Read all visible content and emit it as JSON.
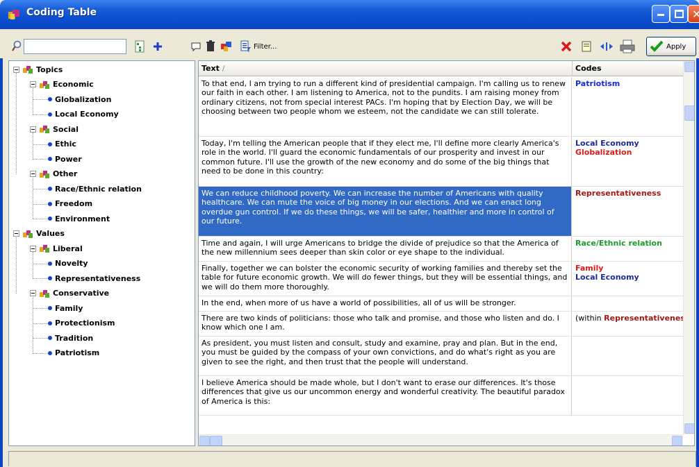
{
  "window": {
    "title": "Coding Table",
    "accent": "#0a47c0"
  },
  "toolbar": {
    "search_value": "",
    "filter_label": "Filter...",
    "apply_label": "Apply",
    "icons": [
      "search-icon",
      "tree-view-icon",
      "add-icon",
      "comment-icon",
      "delete-icon",
      "recode-icon",
      "filter-icon",
      "clear-codes-icon",
      "memo-icon",
      "fit-columns-icon",
      "print-icon",
      "checkmark-icon"
    ]
  },
  "tree": {
    "nodes": [
      {
        "label": "Topics",
        "type": "folder",
        "level": 0
      },
      {
        "label": "Economic",
        "type": "folder",
        "level": 1
      },
      {
        "label": "Globalization",
        "type": "code",
        "level": 2
      },
      {
        "label": "Local Economy",
        "type": "code",
        "level": 2
      },
      {
        "label": "Social",
        "type": "folder",
        "level": 1
      },
      {
        "label": "Ethic",
        "type": "code",
        "level": 2
      },
      {
        "label": "Power",
        "type": "code",
        "level": 2
      },
      {
        "label": "Other",
        "type": "folder",
        "level": 1
      },
      {
        "label": "Race/Ethnic relation",
        "type": "code",
        "level": 2
      },
      {
        "label": "Freedom",
        "type": "code",
        "level": 2
      },
      {
        "label": "Environment",
        "type": "code",
        "level": 2
      },
      {
        "label": "Values",
        "type": "folder",
        "level": 0
      },
      {
        "label": "Liberal",
        "type": "folder",
        "level": 1
      },
      {
        "label": "Novelty",
        "type": "code",
        "level": 2
      },
      {
        "label": "Representativeness",
        "type": "code",
        "level": 2
      },
      {
        "label": "Conservative",
        "type": "folder",
        "level": 1
      },
      {
        "label": "Family",
        "type": "code",
        "level": 2
      },
      {
        "label": "Protectionism",
        "type": "code",
        "level": 2
      },
      {
        "label": "Tradition",
        "type": "code",
        "level": 2
      },
      {
        "label": "Patriotism",
        "type": "code",
        "level": 2
      }
    ]
  },
  "table": {
    "columns": [
      "Text",
      "Codes"
    ],
    "sort_indicator": "/",
    "rows": [
      {
        "text": "To that end, I am trying to run a different kind of presidential campaign. I'm calling us to renew our faith in each other. I am listening to America, not to the pundits. I am raising money from ordinary citizens, not from special interest PACs. I'm hoping that by Election Day, we will be choosing between two people whom we esteem, not the candidate we can still tolerate.",
        "codes": [
          {
            "label": "Patriotism",
            "color": "#1a2ad8"
          }
        ],
        "selected": false
      },
      {
        "text": "Today, I'm telling the American people that if they elect me, I'll define more clearly America's role in the world. I'll guard the economic fundamentals of our prosperity and invest in our common future. I'll use the growth of the new economy and do some of the big things that need to be done in this country:",
        "codes": [
          {
            "label": "Local Economy",
            "color": "#1a2a9a"
          },
          {
            "label": "Globalization",
            "color": "#e01818"
          }
        ],
        "selected": false
      },
      {
        "text": "We can reduce childhood poverty. We can increase the number of Americans with quality healthcare. We can mute the voice of big money in our elections. And we can enact long overdue gun control. If we do these things, we will be safer, healthier and more in control of our future.",
        "codes": [
          {
            "label": "Representativeness",
            "color": "#a01818"
          }
        ],
        "selected": true
      },
      {
        "text": "Time and again, I will urge Americans to bridge the divide of prejudice so that the America of the new millennium sees deeper than skin color or eye shape to the individual.",
        "codes": [
          {
            "label": "Race/Ethnic relation",
            "color": "#1a9a2a"
          }
        ],
        "selected": false
      },
      {
        "text": "Finally, together we can bolster the economic security of working families and thereby set the table for future economic growth. We will do fewer things, but they will be essential things, and we will do them more thoroughly.",
        "codes": [
          {
            "label": "Family",
            "color": "#e01818"
          },
          {
            "label": "Local Economy",
            "color": "#1a2a9a"
          }
        ],
        "selected": false
      },
      {
        "text": "In the end, when more of us have a world of possibilities, all of us will be stronger.",
        "codes": [],
        "selected": false
      },
      {
        "text": "There are two kinds of politicians: those who talk and promise, and those who listen and do. I know which one I am.",
        "codes": [
          {
            "label": "Representativenes",
            "prefix": "(within ",
            "color": "#a01818"
          }
        ],
        "selected": false
      },
      {
        "text": "As president, you must listen and consult, study and examine, pray and plan. But in the end, you must be guided by the compass of your own convictions, and do what's right as you are given to see the right, and then trust that the people will understand.",
        "codes": [],
        "selected": false
      },
      {
        "text": "I believe America should be made whole, but I don't want to erase our differences. It's those differences that give us our uncommon energy and wonderful creativity. The beautiful paradox of America is this:",
        "codes": [],
        "selected": false
      }
    ]
  },
  "status": {
    "text": ""
  }
}
